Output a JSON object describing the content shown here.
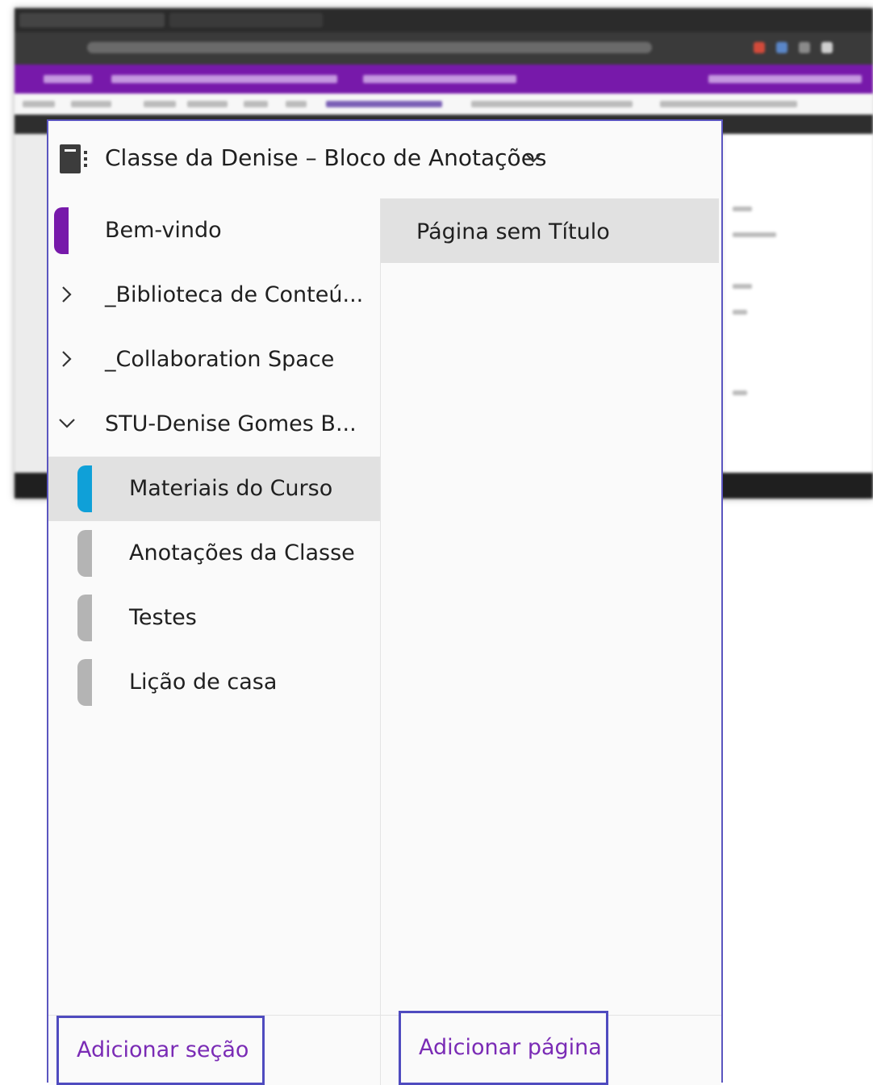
{
  "notebook": {
    "title": "Classe da Denise – Bloco de Anotações",
    "icon": "notebook-icon",
    "chevron_icon": "chevron-down-icon"
  },
  "sections": {
    "items": [
      {
        "label": "Bem-vindo",
        "color": "#7719aa",
        "kind": "section"
      },
      {
        "label": "_Biblioteca de Conteú...",
        "kind": "group",
        "state": "collapsed"
      },
      {
        "label": "_Collaboration Space",
        "kind": "group",
        "state": "collapsed"
      },
      {
        "label": "STU-Denise Gomes B...",
        "kind": "group",
        "state": "expanded"
      },
      {
        "label": "Materiais do Curso",
        "color": "#0fa0d8",
        "kind": "subsection",
        "selected": true
      },
      {
        "label": "Anotações da Classe",
        "color": "#b4b4b4",
        "kind": "subsection"
      },
      {
        "label": "Testes",
        "color": "#b4b4b4",
        "kind": "subsection"
      },
      {
        "label": "Lição de casa",
        "color": "#b4b4b4",
        "kind": "subsection"
      }
    ],
    "add_label": "Adicionar seção"
  },
  "pages": {
    "items": [
      {
        "label": "Página sem Título",
        "selected": true
      }
    ],
    "add_label": "Adicionar página"
  },
  "colors": {
    "accent_purple": "#7719aa",
    "link_purple": "#7a2bb5",
    "highlight_border": "#4f4bbf",
    "selected_bg": "#e1e1e1"
  }
}
